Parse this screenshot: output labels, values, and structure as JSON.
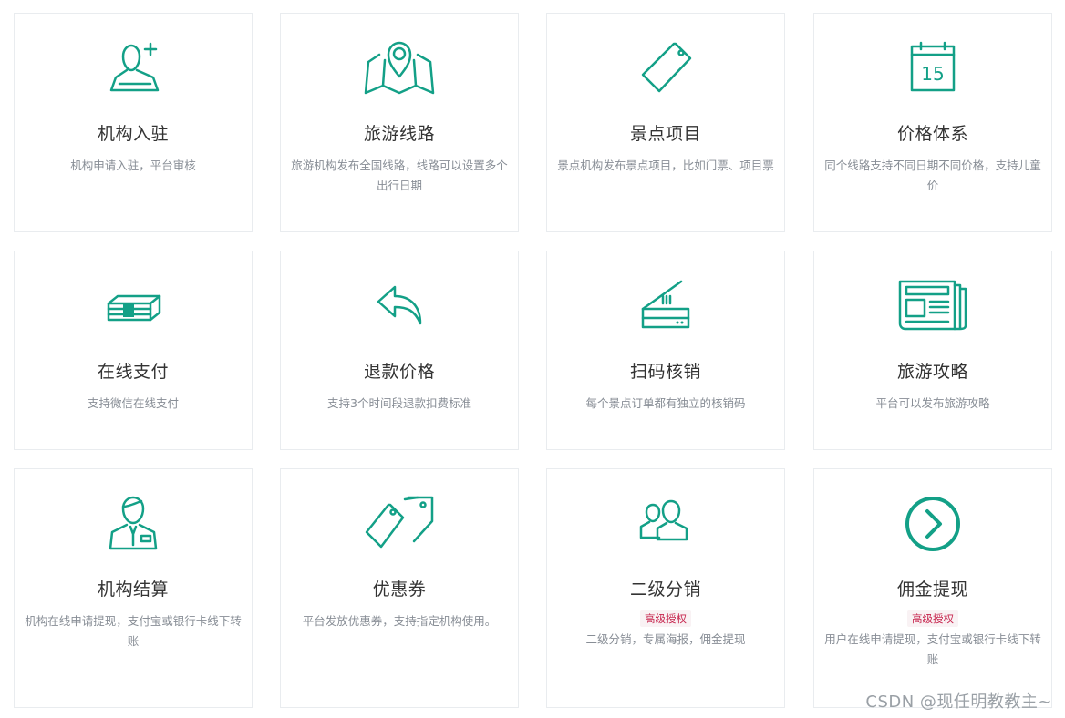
{
  "cards": [
    {
      "title": "机构入驻",
      "desc": "机构申请入驻，平台审核",
      "icon": "user-add-icon"
    },
    {
      "title": "旅游线路",
      "desc": "旅游机构发布全国线路，线路可以设置多个出行日期",
      "icon": "map-pin-icon"
    },
    {
      "title": "景点项目",
      "desc": "景点机构发布景点项目，比如门票、项目票",
      "icon": "tag-icon"
    },
    {
      "title": "价格体系",
      "desc": "同个线路支持不同日期不同价格，支持儿童价",
      "icon": "calendar-icon",
      "calendar_day": "15"
    },
    {
      "title": "在线支付",
      "desc": "支持微信在线支付",
      "icon": "money-stack-icon"
    },
    {
      "title": "退款价格",
      "desc": "支持3个时间段退款扣费标准",
      "icon": "reply-arrow-icon"
    },
    {
      "title": "扫码核销",
      "desc": "每个景点订单都有独立的核销码",
      "icon": "scanner-icon"
    },
    {
      "title": "旅游攻略",
      "desc": "平台可以发布旅游攻略",
      "icon": "newspaper-icon"
    },
    {
      "title": "机构结算",
      "desc": "机构在线申请提现，支付宝或银行卡线下转账",
      "icon": "businessman-icon"
    },
    {
      "title": "优惠券",
      "desc": "平台发放优惠券，支持指定机构使用。",
      "icon": "tags-icon"
    },
    {
      "title": "二级分销",
      "badge": "高级授权",
      "desc": "二级分销，专属海报，佣金提现",
      "icon": "users-icon"
    },
    {
      "title": "佣金提现",
      "badge": "高级授权",
      "desc": "用户在线申请提现，支付宝或银行卡线下转账",
      "icon": "chevron-circle-right-icon"
    }
  ],
  "watermark": "CSDN @现任明教教主~",
  "colors": {
    "accent": "#13a087",
    "badge_text": "#c7254e",
    "badge_bg": "#f9f2f4"
  }
}
